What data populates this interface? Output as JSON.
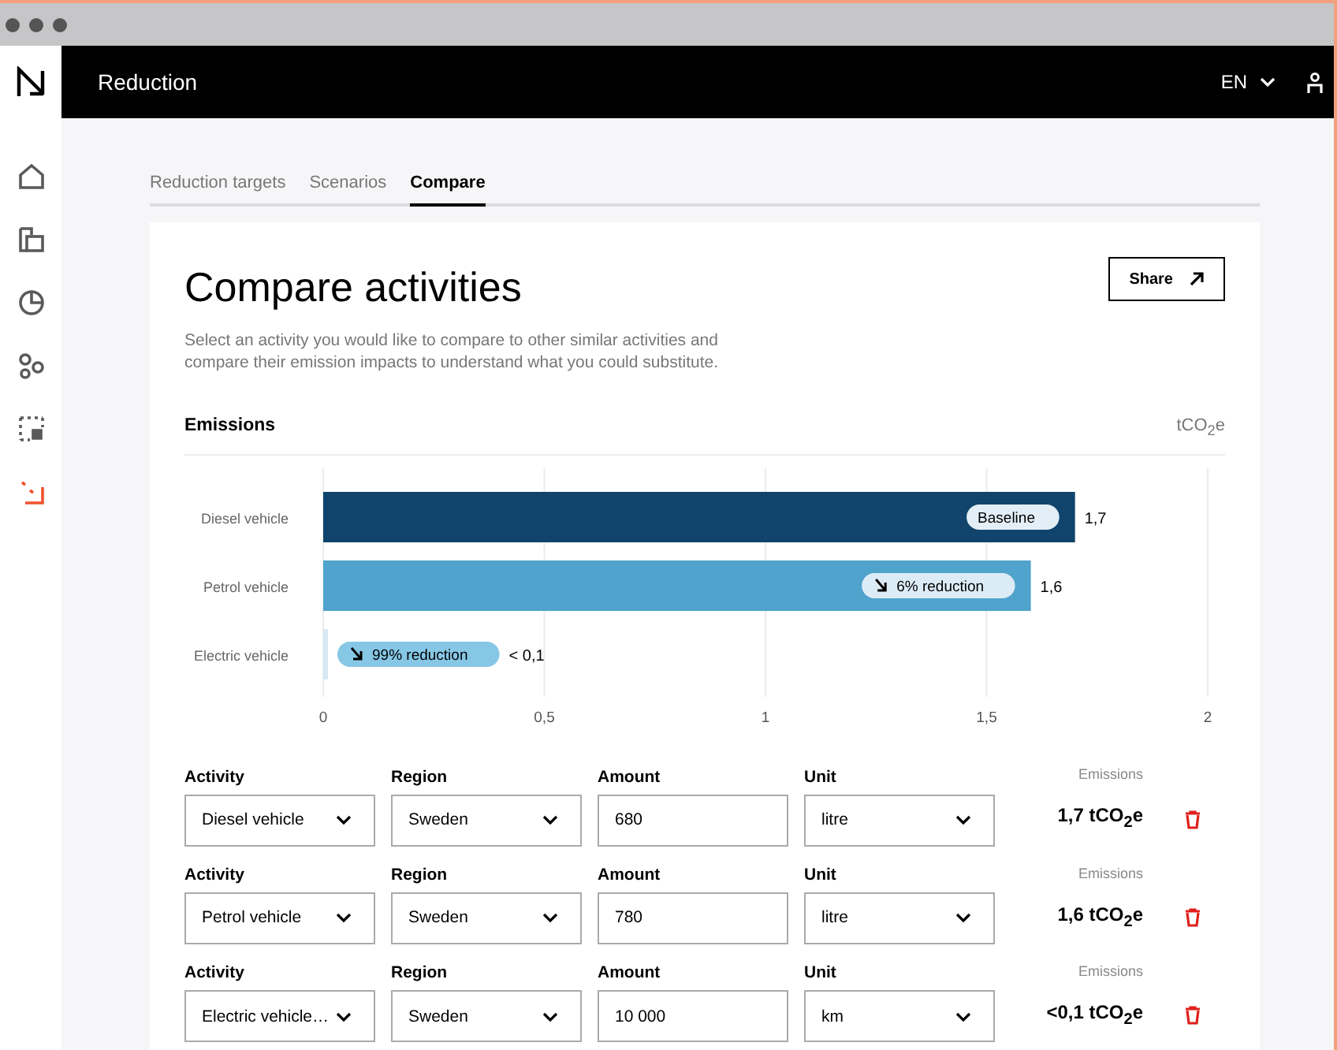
{
  "window": {
    "title": "Reduction"
  },
  "header": {
    "language": "EN"
  },
  "sidebar": {
    "items": [
      {
        "selected": false
      },
      {
        "selected": false
      },
      {
        "selected": false
      },
      {
        "selected": false
      },
      {
        "selected": false
      },
      {
        "selected": true
      }
    ]
  },
  "tabs": [
    {
      "label": "Reduction targets",
      "selected": false
    },
    {
      "label": "Scenarios",
      "selected": false
    },
    {
      "label": "Compare",
      "selected": true
    }
  ],
  "card": {
    "title": "Compare activities",
    "description": "Select an activity you would like to compare to other similar activities and compare their emission impacts to understand what you could substitute.",
    "share_button": "Share"
  },
  "emissions": {
    "title": "Emissions",
    "unit": "tCO$_{2}$e",
    "chart_data": {
      "type": "bar",
      "orientation": "horizontal",
      "categories": [
        "Diesel vehicle",
        "Petrol vehicle",
        "Electric vehicle"
      ],
      "series": [
        {
          "color": "#10446c",
          "values": [
            1.7,
            null,
            null
          ]
        },
        {
          "color": "#4fa3cc",
          "values": [
            null,
            1.6,
            null
          ]
        },
        {
          "color": "#d6e9f5",
          "values": [
            null,
            null,
            0.01
          ]
        }
      ],
      "grid": true,
      "value_labels": [
        "1,7",
        "1,6",
        "< 0,1"
      ],
      "xlim": [
        0,
        2
      ],
      "xticks": [
        {
          "value": 0,
          "label": "0"
        },
        {
          "value": 0.5,
          "label": "0,5"
        },
        {
          "value": 1,
          "label": "1"
        },
        {
          "value": 1.5,
          "label": "1,5"
        },
        {
          "value": 2,
          "label": "2"
        }
      ]
    },
    "badges": [
      {
        "kind": "baseline",
        "label": "Baseline"
      },
      {
        "kind": "reduction",
        "label": "6% reduction"
      },
      {
        "kind": "reduction",
        "label": "99% reduction"
      }
    ]
  },
  "rows": [
    {
      "activity_label": "Activity",
      "activity": "Diesel vehicle",
      "region_label": "Region",
      "region": "Sweden",
      "amount_label": "Amount",
      "amount": "680",
      "unit_label": "Unit",
      "unit": "litre",
      "emissions_label": "Emissions",
      "emissions": "1,7 tCO$_{2}$e"
    },
    {
      "activity_label": "Activity",
      "activity": "Petrol vehicle",
      "region_label": "Region",
      "region": "Sweden",
      "amount_label": "Amount",
      "amount": "780",
      "unit_label": "Unit",
      "unit": "litre",
      "emissions_label": "Emissions",
      "emissions": "1,6 tCO$_{2}$e"
    },
    {
      "activity_label": "Activity",
      "activity": "Electric vehicle…",
      "region_label": "Region",
      "region": "Sweden",
      "amount_label": "Amount",
      "amount": "10 000",
      "unit_label": "Unit",
      "unit": "km",
      "emissions_label": "Emissions",
      "emissions": "<0,1 tCO$_{2}$e"
    }
  ]
}
